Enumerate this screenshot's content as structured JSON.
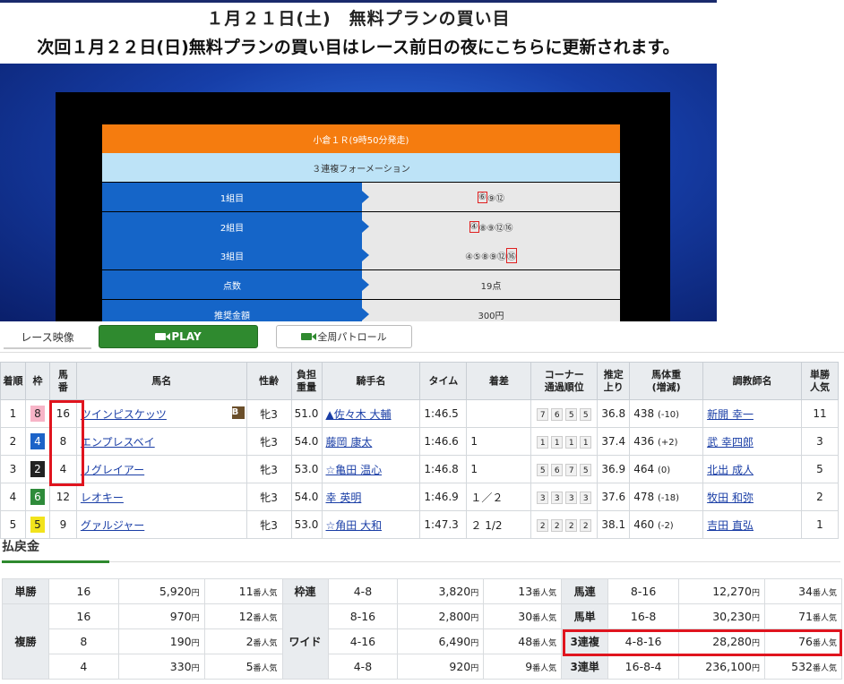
{
  "header": {
    "title": "１月２１日(土)　無料プランの買い目",
    "subtitle": "次回１月２２日(日)無料プランの買い目はレース前日の夜にこちらに更新されます。"
  },
  "picks": {
    "race": "小倉１Ｒ(9時50分発走)",
    "type": "３連複フォーメーション",
    "rows": [
      {
        "label": "1組目",
        "hl": "⑥",
        "rest": "⑨⑫"
      },
      {
        "label": "2組目",
        "hl": "④",
        "rest": "⑧⑨⑫⑯"
      },
      {
        "label": "3組目",
        "pre": "④⑤⑧⑨⑫",
        "hl": "⑯"
      },
      {
        "label": "点数",
        "value": "19点"
      },
      {
        "label": "推奨金額",
        "value": "300円"
      }
    ]
  },
  "video": {
    "label": "レース映像",
    "play": "PLAY",
    "patrol": "全周パトロール"
  },
  "results": {
    "headers": [
      "着順",
      "枠",
      "馬番",
      "馬名",
      "性齢",
      "負担重量",
      "騎手名",
      "タイム",
      "着差",
      "コーナー通過順位",
      "推定上り",
      "馬体重(増減)",
      "調教師名",
      "単勝人気"
    ],
    "header_lines": {
      "h3": [
        "馬",
        "番"
      ],
      "h6": [
        "負担",
        "重量"
      ],
      "h10": [
        "コーナー",
        "通過順位"
      ],
      "h11": [
        "推定",
        "上り"
      ],
      "h12": [
        "馬体重",
        "(増減)"
      ],
      "h14": [
        "単勝",
        "人気"
      ]
    },
    "blinker": "B",
    "rows": [
      {
        "rank": "1",
        "waku": "8",
        "num": "16",
        "horse": "ツインピスケッツ",
        "sex": "牝3",
        "weight": "51.0",
        "jockey": "▲佐々木 大輔",
        "time": "1:46.5",
        "margin": "",
        "corner": [
          "7",
          "6",
          "5",
          "5"
        ],
        "agari": "36.8",
        "bw": "438",
        "bwd": "(-10)",
        "trainer": "新開 幸一",
        "pop": "11"
      },
      {
        "rank": "2",
        "waku": "4",
        "num": "8",
        "horse": "エンプレスベイ",
        "sex": "牝3",
        "weight": "54.0",
        "jockey": "藤岡 康太",
        "time": "1:46.6",
        "margin": "1",
        "corner": [
          "1",
          "1",
          "1",
          "1"
        ],
        "agari": "37.4",
        "bw": "436",
        "bwd": "(+2)",
        "trainer": "武 幸四郎",
        "pop": "3"
      },
      {
        "rank": "3",
        "waku": "2",
        "num": "4",
        "horse": "リグレイアー",
        "sex": "牝3",
        "weight": "53.0",
        "jockey": "☆亀田 温心",
        "time": "1:46.8",
        "margin": "1",
        "corner": [
          "5",
          "6",
          "7",
          "5"
        ],
        "agari": "36.9",
        "bw": "464",
        "bwd": "(0)",
        "trainer": "北出 成人",
        "pop": "5"
      },
      {
        "rank": "4",
        "waku": "6",
        "num": "12",
        "horse": "レオキー",
        "sex": "牝3",
        "weight": "54.0",
        "jockey": "幸 英明",
        "time": "1:46.9",
        "margin": "１／２",
        "corner": [
          "3",
          "3",
          "3",
          "3"
        ],
        "agari": "37.6",
        "bw": "478",
        "bwd": "(-18)",
        "trainer": "牧田 和弥",
        "pop": "2"
      },
      {
        "rank": "5",
        "waku": "5",
        "num": "9",
        "horse": "グァルジャー",
        "sex": "牝3",
        "weight": "53.0",
        "jockey": "☆角田 大和",
        "time": "1:47.3",
        "margin": "２ 1/2",
        "corner": [
          "2",
          "2",
          "2",
          "2"
        ],
        "agari": "38.1",
        "bw": "460",
        "bwd": "(-2)",
        "trainer": "吉田 直弘",
        "pop": "1"
      }
    ]
  },
  "payout": {
    "title": "払戻金",
    "yen": "円",
    "pop_suffix": "番人気",
    "tansho": {
      "label": "単勝",
      "num": "16",
      "amt": "5,920",
      "pop": "11"
    },
    "fukusho": {
      "label": "複勝",
      "rows": [
        {
          "num": "16",
          "amt": "970",
          "pop": "12"
        },
        {
          "num": "8",
          "amt": "190",
          "pop": "2"
        },
        {
          "num": "4",
          "amt": "330",
          "pop": "5"
        }
      ]
    },
    "wakuren": {
      "label": "枠連",
      "num": "4-8",
      "amt": "3,820",
      "pop": "13"
    },
    "wide": {
      "label": "ワイド",
      "rows": [
        {
          "num": "8-16",
          "amt": "2,800",
          "pop": "30"
        },
        {
          "num": "4-16",
          "amt": "6,490",
          "pop": "48"
        },
        {
          "num": "4-8",
          "amt": "920",
          "pop": "9"
        }
      ]
    },
    "umaren": {
      "label": "馬連",
      "num": "8-16",
      "amt": "12,270",
      "pop": "34"
    },
    "umatan": {
      "label": "馬単",
      "num": "16-8",
      "amt": "30,230",
      "pop": "71"
    },
    "sanrenpuku": {
      "label": "3連複",
      "num": "4-8-16",
      "amt": "28,280",
      "pop": "76"
    },
    "sanrentan": {
      "label": "3連単",
      "num": "16-8-4",
      "amt": "236,100",
      "pop": "532"
    }
  }
}
